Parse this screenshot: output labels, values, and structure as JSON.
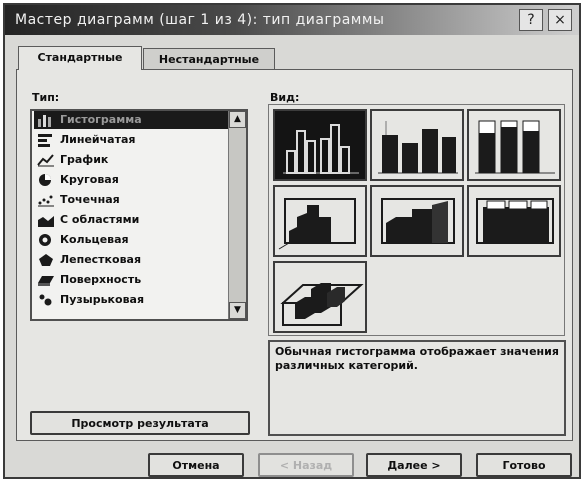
{
  "window": {
    "title": "Мастер диаграмм (шаг 1 из 4): тип диаграммы",
    "help_glyph": "?",
    "close_glyph": "×"
  },
  "tabs": [
    {
      "label": "Стандартные",
      "active": true
    },
    {
      "label": "Нестандартные",
      "active": false
    }
  ],
  "type_list": {
    "label": "Тип:",
    "items": [
      {
        "label": "Гистограмма",
        "icon": "column-chart-icon",
        "selected": true
      },
      {
        "label": "Линейчатая",
        "icon": "bar-chart-icon",
        "selected": false
      },
      {
        "label": "График",
        "icon": "line-chart-icon",
        "selected": false
      },
      {
        "label": "Круговая",
        "icon": "pie-chart-icon",
        "selected": false
      },
      {
        "label": "Точечная",
        "icon": "scatter-chart-icon",
        "selected": false
      },
      {
        "label": "С областями",
        "icon": "area-chart-icon",
        "selected": false
      },
      {
        "label": "Кольцевая",
        "icon": "doughnut-chart-icon",
        "selected": false
      },
      {
        "label": "Лепестковая",
        "icon": "radar-chart-icon",
        "selected": false
      },
      {
        "label": "Поверхность",
        "icon": "surface-chart-icon",
        "selected": false
      },
      {
        "label": "Пузырьковая",
        "icon": "bubble-chart-icon",
        "selected": false
      }
    ]
  },
  "subtypes": {
    "label": "Вид:",
    "selected_index": 0,
    "items": [
      {
        "icon": "clustered-column-icon"
      },
      {
        "icon": "stacked-column-icon"
      },
      {
        "icon": "percent-stacked-column-icon"
      },
      {
        "icon": "3d-clustered-column-icon"
      },
      {
        "icon": "3d-stacked-column-icon"
      },
      {
        "icon": "3d-percent-stacked-column-icon"
      },
      {
        "icon": "3d-column-icon"
      }
    ]
  },
  "description": {
    "text": "Обычная гистограмма отображает значения различных категорий."
  },
  "buttons": {
    "preview": "Просмотр результата",
    "cancel": "Отмена",
    "back": "< Назад",
    "next": "Далее >",
    "finish": "Готово"
  }
}
